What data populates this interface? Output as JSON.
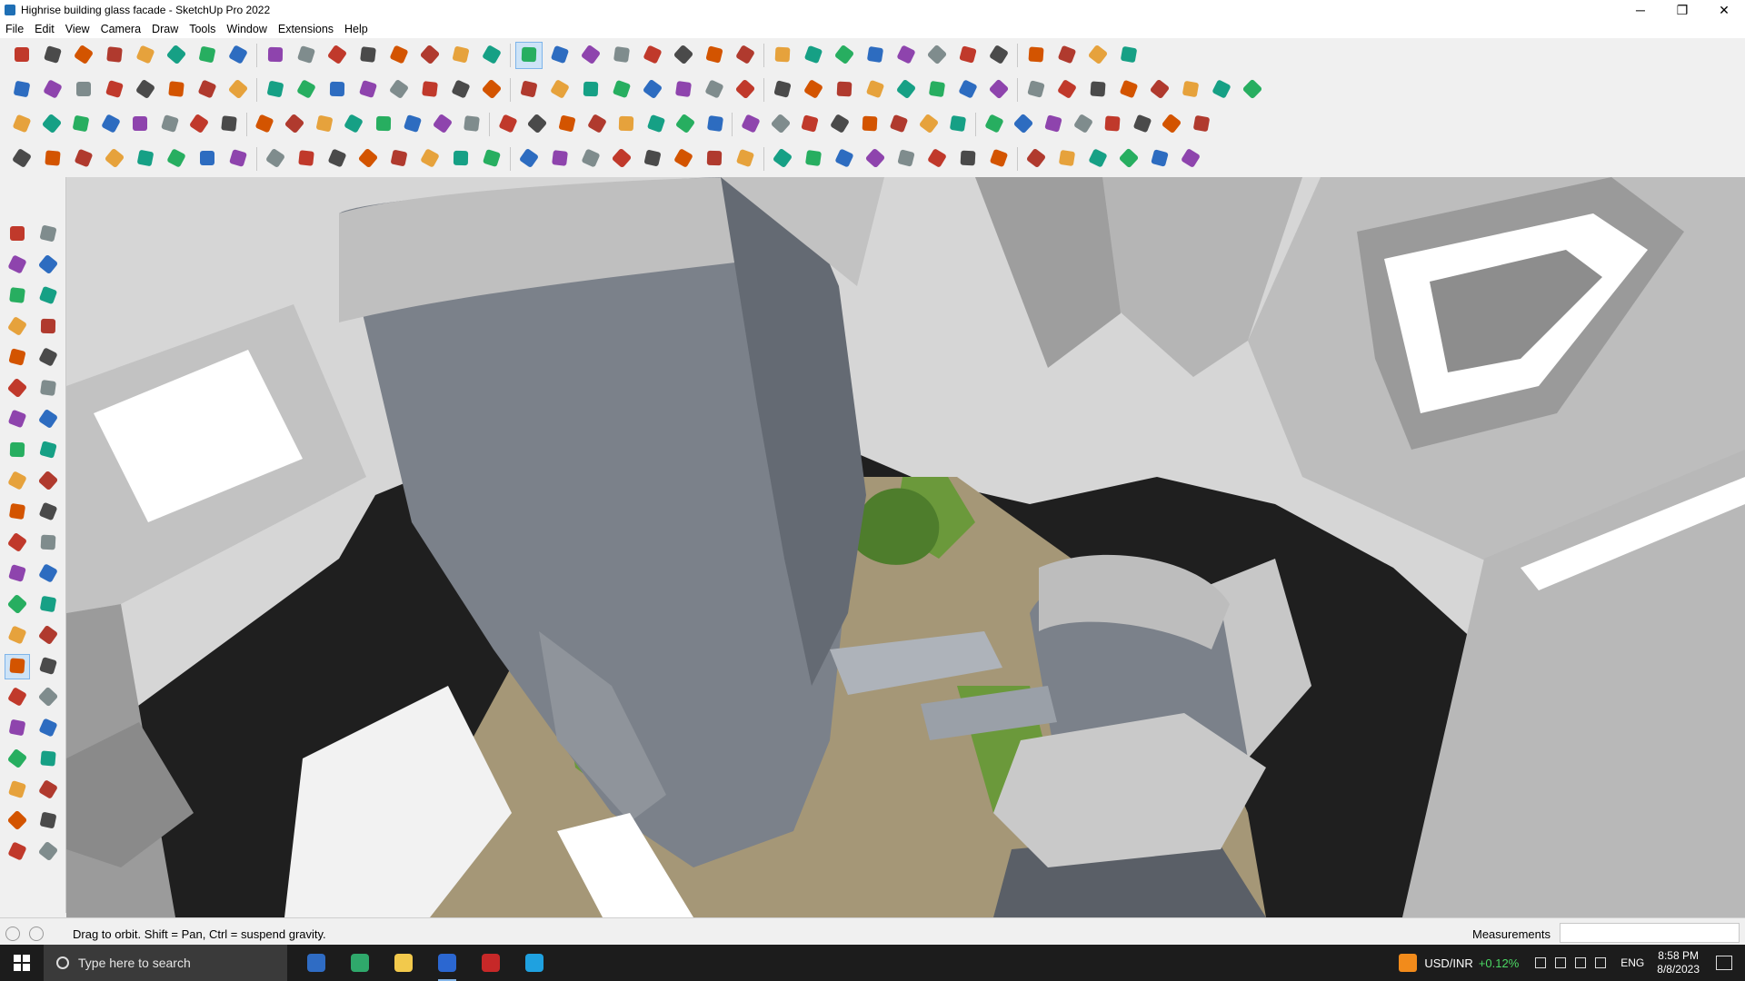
{
  "window": {
    "title": "Highrise building glass facade - SketchUp Pro 2022",
    "controls": [
      "─",
      "❐",
      "✕"
    ]
  },
  "menu": [
    "File",
    "Edit",
    "View",
    "Camera",
    "Draw",
    "Tools",
    "Window",
    "Extensions",
    "Help"
  ],
  "toolbar_rows": [
    {
      "count": 36,
      "active_index": 16,
      "note": ""
    },
    {
      "count": 40,
      "active_index": -1,
      "note": ""
    },
    {
      "count": 40,
      "active_index": -1,
      "note": ""
    },
    {
      "count": 38,
      "active_index": -1,
      "note": ""
    }
  ],
  "left_toolbar": {
    "icons": [
      "select-icon",
      "orbit-icon",
      "paint-bucket-icon",
      "eraser-icon",
      "component-icon",
      "tag-icon",
      "line-icon",
      "freehand-icon",
      "rectangle-icon",
      "rotated-rectangle-icon",
      "circle-icon",
      "polygon-icon",
      "arc-icon",
      "two-point-arc-icon",
      "pie-icon",
      "three-point-arc-icon",
      "move-icon",
      "push-pull-icon",
      "rotate-icon",
      "follow-me-icon",
      "scale-icon",
      "offset-icon",
      "tape-measure-icon",
      "dimension-icon",
      "protractor-icon",
      "text-icon",
      "axes-icon",
      "3d-text-icon",
      "orbit-active-icon",
      "pan-icon",
      "zoom-icon",
      "zoom-window-icon",
      "zoom-extents-icon",
      "previous-view-icon",
      "walk-icon",
      "look-around-icon",
      "position-camera-icon",
      "section-plane-icon",
      "sandbox-icon",
      "smoove-icon",
      "stamp-icon",
      "drape-icon"
    ],
    "active": "orbit-active-icon"
  },
  "status": {
    "text": "Drag to orbit. Shift = Pan, Ctrl = suspend gravity.",
    "measurements_label": "Measurements",
    "measurements_value": ""
  },
  "taskbar": {
    "search_placeholder": "Type here to search",
    "apps": [
      "task-view-icon",
      "calculator-icon",
      "file-explorer-icon",
      "sketchup-icon",
      "acrobat-icon",
      "edge-icon"
    ],
    "ticker": "USD/INR",
    "ticker_change": "+0.12%",
    "language": "ENG",
    "time": "8:58 PM",
    "date": "8/8/2023"
  },
  "colors": {
    "accent": "#cde3f7",
    "gain": "#4cd964",
    "sky_ground": "#d4d4d4",
    "road": "#1e1e1e",
    "glass": "#7d8590",
    "grass": "#6d9a3c",
    "paving": "#a89a80"
  }
}
